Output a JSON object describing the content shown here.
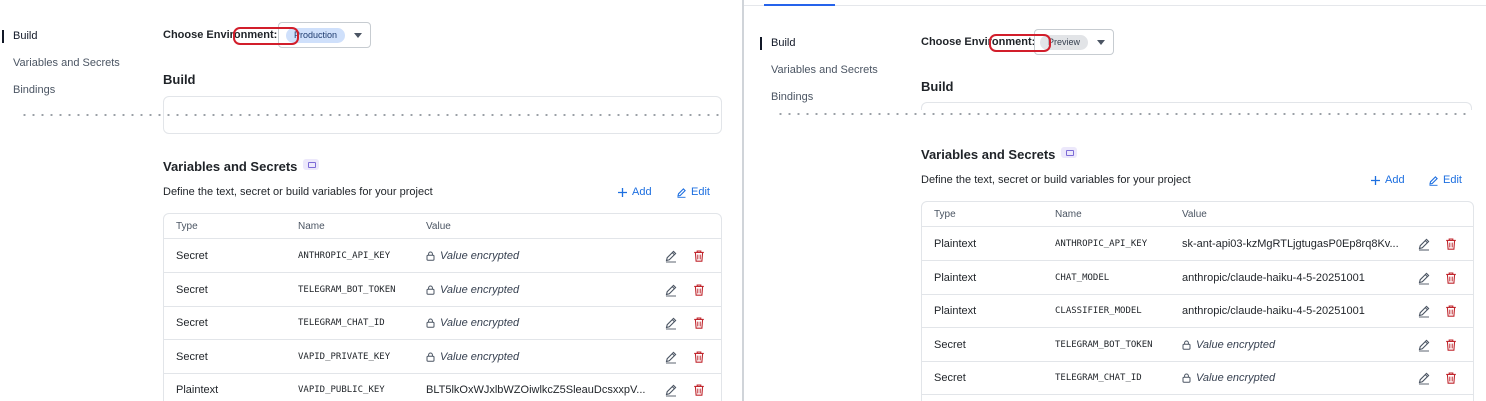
{
  "left": {
    "nav": [
      {
        "label": "Build",
        "active": true
      },
      {
        "label": "Variables and Secrets",
        "active": false
      },
      {
        "label": "Bindings",
        "active": false
      }
    ],
    "env_label": "Choose Environment:",
    "env_value": "Production",
    "build_title": "Build",
    "vars_title": "Variables and Secrets",
    "description": "Define the text, secret or build variables for your project",
    "add_label": "Add",
    "edit_label": "Edit",
    "columns": [
      "Type",
      "Name",
      "Value"
    ],
    "rows": [
      {
        "type": "Secret",
        "name": "ANTHROPIC_API_KEY",
        "value": "Value encrypted",
        "encrypted": true
      },
      {
        "type": "Secret",
        "name": "TELEGRAM_BOT_TOKEN",
        "value": "Value encrypted",
        "encrypted": true
      },
      {
        "type": "Secret",
        "name": "TELEGRAM_CHAT_ID",
        "value": "Value encrypted",
        "encrypted": true
      },
      {
        "type": "Secret",
        "name": "VAPID_PRIVATE_KEY",
        "value": "Value encrypted",
        "encrypted": true
      },
      {
        "type": "Plaintext",
        "name": "VAPID_PUBLIC_KEY",
        "value": "BLT5lkOxWJxlbWZOiwlkcZ5SleauDcsxxpV...",
        "encrypted": false
      }
    ]
  },
  "right": {
    "nav": [
      {
        "label": "Build",
        "active": true
      },
      {
        "label": "Variables and Secrets",
        "active": false
      },
      {
        "label": "Bindings",
        "active": false
      }
    ],
    "env_label": "Choose Environment:",
    "env_value": "Preview",
    "build_title": "Build",
    "vars_title": "Variables and Secrets",
    "description": "Define the text, secret or build variables for your project",
    "add_label": "Add",
    "edit_label": "Edit",
    "columns": [
      "Type",
      "Name",
      "Value"
    ],
    "rows": [
      {
        "type": "Plaintext",
        "name": "ANTHROPIC_API_KEY",
        "value": "sk-ant-api03-kzMgRTLjgtugasP0Ep8rq8Kv...",
        "encrypted": false
      },
      {
        "type": "Plaintext",
        "name": "CHAT_MODEL",
        "value": "anthropic/claude-haiku-4-5-20251001",
        "encrypted": false
      },
      {
        "type": "Plaintext",
        "name": "CLASSIFIER_MODEL",
        "value": "anthropic/claude-haiku-4-5-20251001",
        "encrypted": false
      },
      {
        "type": "Secret",
        "name": "TELEGRAM_BOT_TOKEN",
        "value": "Value encrypted",
        "encrypted": true
      },
      {
        "type": "Secret",
        "name": "TELEGRAM_CHAT_ID",
        "value": "Value encrypted",
        "encrypted": true
      }
    ]
  },
  "colors": {
    "accent": "#1d6fe0",
    "delete": "#c0262d",
    "annotation": "#d21e2b",
    "production_pill": "#cfe0fb",
    "preview_pill": "#e2e4e7"
  },
  "icons": [
    "plus-icon",
    "pencil-icon",
    "trash-icon",
    "lock-icon",
    "chevron-down-icon",
    "doc-icon"
  ]
}
